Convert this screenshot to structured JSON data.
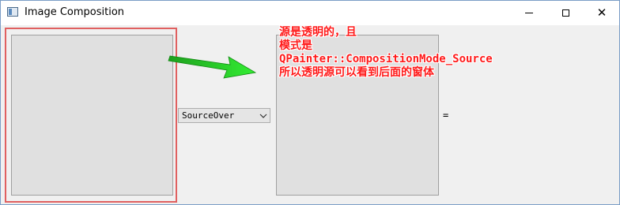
{
  "window": {
    "title": "Image Composition",
    "min_icon": "minimize-icon",
    "max_icon": "maximize-icon",
    "close_icon": "close-icon"
  },
  "combo": {
    "selected": "SourceOver",
    "arrow_icon": "chevron-down-icon"
  },
  "equals_sign": "=",
  "annotation": {
    "lines": [
      "源是透明的，且",
      "模式是",
      "QPainter::CompositionMode_Source",
      "所以透明源可以看到后面的窗体"
    ],
    "color": "#ff1a1a"
  },
  "colors": {
    "highlight_border": "#e06060",
    "arrow": "#22dd22",
    "panel_fill": "#e0e0e0"
  }
}
